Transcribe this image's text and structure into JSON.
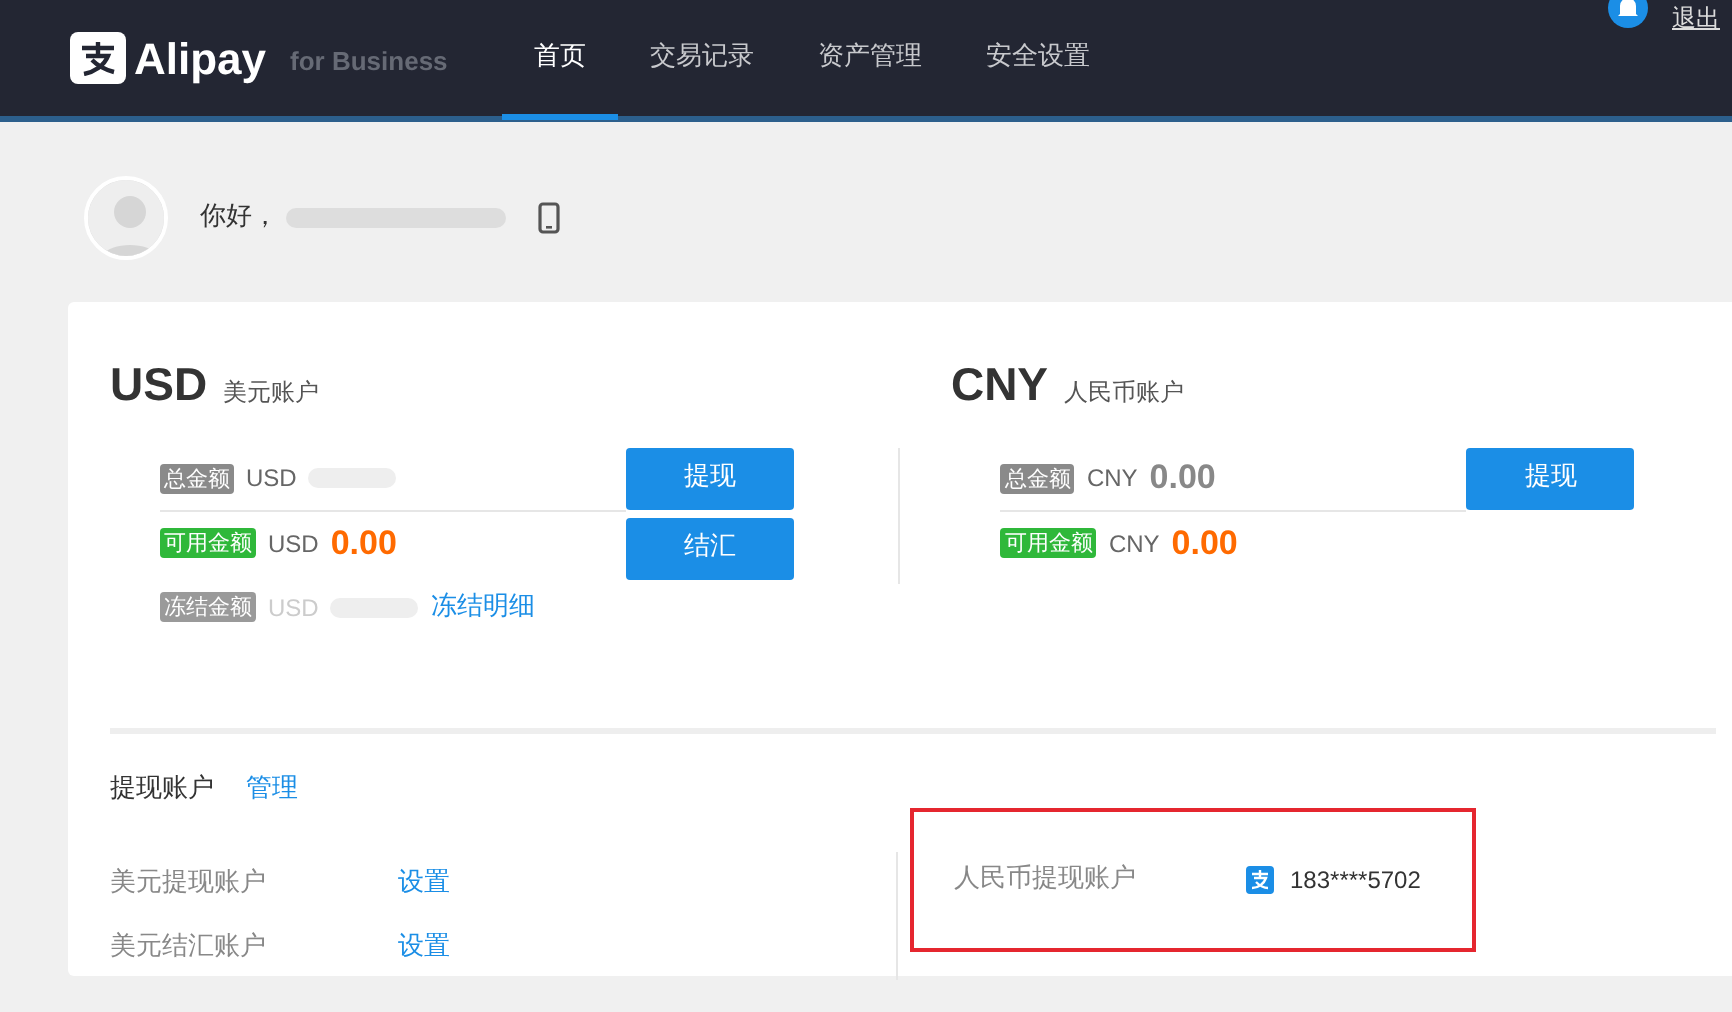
{
  "header": {
    "logo_text": "Alipay",
    "logo_suffix": "for Business",
    "nav": [
      {
        "label": "首页",
        "selected": true
      },
      {
        "label": "交易记录",
        "selected": false
      },
      {
        "label": "资产管理",
        "selected": false
      },
      {
        "label": "安全设置",
        "selected": false
      }
    ],
    "logout": "退出"
  },
  "greeting": {
    "text": "你好，"
  },
  "accounts": [
    {
      "currency": "USD",
      "name": "美元账户",
      "rows": [
        {
          "kind": "total",
          "tag": "总金额",
          "unit": "USD",
          "redacted": true
        },
        {
          "kind": "available",
          "tag": "可用金额",
          "unit": "USD",
          "amount": "0.00",
          "redacted": false
        },
        {
          "kind": "frozen",
          "tag": "冻结金额",
          "unit": "USD",
          "redacted": true,
          "link": "冻结明细"
        }
      ],
      "buttons": [
        "提现",
        "结汇"
      ]
    },
    {
      "currency": "CNY",
      "name": "人民币账户",
      "rows": [
        {
          "kind": "total",
          "tag": "总金额",
          "unit": "CNY",
          "amount": "0.00",
          "redacted": false
        },
        {
          "kind": "available",
          "tag": "可用金额",
          "unit": "CNY",
          "amount": "0.00",
          "redacted": false
        }
      ],
      "buttons": [
        "提现"
      ]
    }
  ],
  "withdraw": {
    "title": "提现账户",
    "manage": "管理",
    "left": [
      {
        "label": "美元提现账户",
        "action": "设置"
      },
      {
        "label": "美元结汇账户",
        "action": "设置"
      }
    ],
    "right": [
      {
        "label": "人民币提现账户",
        "account": "183****5702",
        "highlighted": true
      }
    ]
  }
}
